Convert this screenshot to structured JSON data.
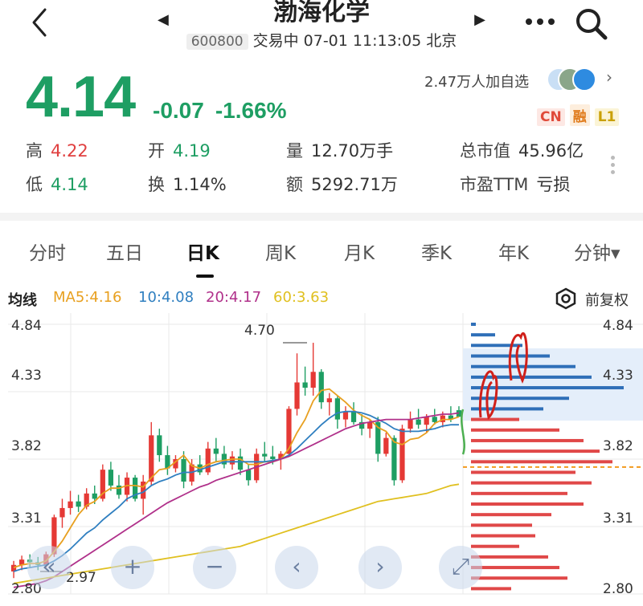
{
  "header": {
    "stock_name": "渤海化学",
    "code": "600800",
    "status": "交易中 07-01 11:13:05 北京",
    "nav_prev": "◀",
    "nav_next": "▶",
    "icons": [
      "back-chevron-icon",
      "more-dots-icon",
      "search-icon"
    ]
  },
  "quote": {
    "price": "4.14",
    "change": "-0.07",
    "change_pct": "-1.66%",
    "followers": "2.47万人加自选",
    "badges": [
      "CN",
      "融",
      "L1"
    ],
    "colors": {
      "down": "#1e9e63",
      "up": "#e04040"
    }
  },
  "stats": {
    "high_label": "高",
    "high": "4.22",
    "open_label": "开",
    "open": "4.19",
    "volume_label": "量",
    "volume": "12.70万手",
    "mktcap_label": "总市值",
    "mktcap": "45.96亿",
    "low_label": "低",
    "low": "4.14",
    "turnover_label": "换",
    "turnover": "1.14%",
    "amount_label": "额",
    "amount": "5292.71万",
    "pe_label": "市盈TTM",
    "pe": "亏损"
  },
  "tabs": [
    "分时",
    "五日",
    "日K",
    "周K",
    "月K",
    "季K",
    "年K",
    "分钟▾"
  ],
  "active_tab": "日K",
  "ma_bar": {
    "title": "均线",
    "ma5": "MA5:4.16",
    "ma10": "10:4.08",
    "ma20": "20:4.17",
    "ma60": "60:3.63",
    "adjust": "前复权",
    "colors": {
      "ma5": "#e8a020",
      "ma10": "#2f7fc0",
      "ma20": "#b0308a",
      "ma60": "#e0c020"
    }
  },
  "chart": {
    "y_labels": [
      "4.84",
      "4.33",
      "3.82",
      "3.31",
      "2.80"
    ],
    "max_marker": "4.70",
    "min_marker": "2.97",
    "controls": [
      "«",
      "+",
      "−",
      "‹",
      "›",
      "⤢"
    ]
  },
  "chart_data": {
    "type": "candlestick",
    "ylim": [
      2.8,
      4.84
    ],
    "ohlc": [
      [
        2.97,
        3.05,
        2.92,
        3.02
      ],
      [
        3.02,
        3.09,
        2.98,
        3.06
      ],
      [
        3.06,
        3.1,
        3.0,
        3.04
      ],
      [
        3.04,
        3.08,
        2.98,
        3.02
      ],
      [
        3.02,
        3.12,
        3.0,
        3.1
      ],
      [
        3.1,
        3.4,
        3.08,
        3.38
      ],
      [
        3.38,
        3.52,
        3.3,
        3.45
      ],
      [
        3.45,
        3.58,
        3.4,
        3.5
      ],
      [
        3.5,
        3.55,
        3.42,
        3.46
      ],
      [
        3.46,
        3.6,
        3.44,
        3.56
      ],
      [
        3.56,
        3.62,
        3.48,
        3.52
      ],
      [
        3.52,
        3.78,
        3.5,
        3.74
      ],
      [
        3.74,
        3.8,
        3.58,
        3.62
      ],
      [
        3.62,
        3.7,
        3.52,
        3.55
      ],
      [
        3.55,
        3.72,
        3.5,
        3.68
      ],
      [
        3.68,
        3.7,
        3.5,
        3.52
      ],
      [
        3.52,
        3.7,
        3.4,
        3.65
      ],
      [
        3.65,
        4.1,
        3.62,
        4.0
      ],
      [
        4.0,
        4.05,
        3.8,
        3.85
      ],
      [
        3.85,
        3.92,
        3.7,
        3.75
      ],
      [
        3.75,
        3.85,
        3.72,
        3.82
      ],
      [
        3.82,
        3.88,
        3.6,
        3.65
      ],
      [
        3.65,
        3.82,
        3.62,
        3.78
      ],
      [
        3.78,
        3.85,
        3.7,
        3.72
      ],
      [
        3.72,
        3.95,
        3.7,
        3.9
      ],
      [
        3.9,
        3.98,
        3.8,
        3.86
      ],
      [
        3.86,
        3.92,
        3.75,
        3.78
      ],
      [
        3.78,
        3.88,
        3.74,
        3.84
      ],
      [
        3.84,
        3.9,
        3.7,
        3.74
      ],
      [
        3.74,
        3.78,
        3.62,
        3.66
      ],
      [
        3.66,
        3.9,
        3.64,
        3.86
      ],
      [
        3.86,
        3.95,
        3.8,
        3.84
      ],
      [
        3.84,
        3.92,
        3.78,
        3.82
      ],
      [
        3.82,
        3.88,
        3.74,
        3.86
      ],
      [
        3.86,
        4.22,
        3.84,
        4.2
      ],
      [
        4.2,
        4.62,
        4.15,
        4.4
      ],
      [
        4.4,
        4.52,
        4.3,
        4.36
      ],
      [
        4.36,
        4.7,
        4.3,
        4.48
      ],
      [
        4.48,
        4.5,
        4.2,
        4.25
      ],
      [
        4.25,
        4.32,
        4.15,
        4.28
      ],
      [
        4.28,
        4.3,
        4.05,
        4.12
      ],
      [
        4.12,
        4.22,
        4.06,
        4.18
      ],
      [
        4.18,
        4.25,
        4.08,
        4.1
      ],
      [
        4.1,
        4.16,
        4.0,
        4.05
      ],
      [
        4.05,
        4.12,
        3.98,
        4.1
      ],
      [
        4.1,
        4.14,
        3.8,
        3.86
      ],
      [
        3.86,
        4.02,
        3.84,
        3.98
      ],
      [
        3.98,
        4.0,
        3.62,
        3.66
      ],
      [
        3.66,
        4.08,
        3.64,
        4.05
      ],
      [
        4.05,
        4.18,
        4.02,
        4.12
      ],
      [
        4.12,
        4.2,
        4.05,
        4.08
      ],
      [
        4.08,
        4.16,
        4.02,
        4.14
      ],
      [
        4.14,
        4.2,
        4.08,
        4.1
      ],
      [
        4.1,
        4.18,
        4.06,
        4.15
      ],
      [
        4.15,
        4.22,
        4.1,
        4.12
      ],
      [
        4.19,
        4.22,
        4.14,
        4.14
      ]
    ],
    "ma_series": [
      {
        "name": "MA5",
        "values": [
          3.0,
          3.02,
          3.03,
          3.03,
          3.05,
          3.12,
          3.2,
          3.3,
          3.4,
          3.47,
          3.5,
          3.56,
          3.6,
          3.6,
          3.62,
          3.62,
          3.61,
          3.68,
          3.74,
          3.75,
          3.8,
          3.85,
          3.77,
          3.75,
          3.78,
          3.8,
          3.81,
          3.82,
          3.82,
          3.78,
          3.78,
          3.8,
          3.8,
          3.82,
          3.9,
          4.02,
          4.12,
          4.26,
          4.34,
          4.35,
          4.3,
          4.25,
          4.19,
          4.15,
          4.12,
          4.06,
          4.03,
          3.95,
          3.93,
          3.97,
          3.98,
          4.02,
          4.09,
          4.12,
          4.12,
          4.14
        ]
      },
      {
        "name": "MA10",
        "values": [
          2.97,
          2.99,
          3.0,
          3.01,
          3.02,
          3.05,
          3.09,
          3.14,
          3.2,
          3.26,
          3.3,
          3.36,
          3.41,
          3.46,
          3.52,
          3.55,
          3.57,
          3.62,
          3.65,
          3.67,
          3.7,
          3.72,
          3.72,
          3.74,
          3.76,
          3.78,
          3.8,
          3.8,
          3.8,
          3.8,
          3.8,
          3.8,
          3.81,
          3.82,
          3.85,
          3.9,
          3.96,
          4.02,
          4.08,
          4.13,
          4.17,
          4.18,
          4.18,
          4.17,
          4.15,
          4.12,
          4.09,
          4.05,
          4.03,
          4.03,
          4.03,
          4.04,
          4.05,
          4.07,
          4.08,
          4.08
        ]
      },
      {
        "name": "MA20",
        "values": [
          2.85,
          2.86,
          2.87,
          2.88,
          2.9,
          2.93,
          2.97,
          3.01,
          3.05,
          3.09,
          3.13,
          3.17,
          3.21,
          3.25,
          3.29,
          3.33,
          3.37,
          3.41,
          3.45,
          3.49,
          3.52,
          3.55,
          3.58,
          3.61,
          3.63,
          3.66,
          3.68,
          3.7,
          3.72,
          3.74,
          3.76,
          3.78,
          3.8,
          3.82,
          3.84,
          3.87,
          3.9,
          3.93,
          3.96,
          3.99,
          4.02,
          4.05,
          4.07,
          4.09,
          4.1,
          4.11,
          4.12,
          4.12,
          4.12,
          4.12,
          4.13,
          4.14,
          4.15,
          4.16,
          4.16,
          4.17
        ]
      },
      {
        "name": "MA60",
        "values": [
          2.88,
          2.89,
          2.9,
          2.91,
          2.92,
          2.93,
          2.94,
          2.95,
          2.96,
          2.97,
          2.98,
          2.99,
          3.0,
          3.01,
          3.02,
          3.03,
          3.04,
          3.05,
          3.06,
          3.07,
          3.08,
          3.09,
          3.1,
          3.11,
          3.12,
          3.13,
          3.14,
          3.15,
          3.16,
          3.18,
          3.2,
          3.22,
          3.24,
          3.26,
          3.28,
          3.3,
          3.32,
          3.34,
          3.36,
          3.38,
          3.4,
          3.42,
          3.44,
          3.46,
          3.48,
          3.5,
          3.51,
          3.52,
          3.53,
          3.54,
          3.55,
          3.56,
          3.58,
          3.6,
          3.62,
          3.63
        ]
      }
    ],
    "volume_profile": {
      "price_levels_high": [
        4.84,
        4.76,
        4.68,
        4.6,
        4.52,
        4.44,
        4.36,
        4.28,
        4.2
      ],
      "price_levels_low": [
        4.12,
        4.04,
        3.96,
        3.88,
        3.8,
        3.72,
        3.64,
        3.56,
        3.48,
        3.4,
        3.32,
        3.24,
        3.16,
        3.08,
        3.0,
        2.92,
        2.84
      ],
      "current_price": 3.76
    }
  }
}
